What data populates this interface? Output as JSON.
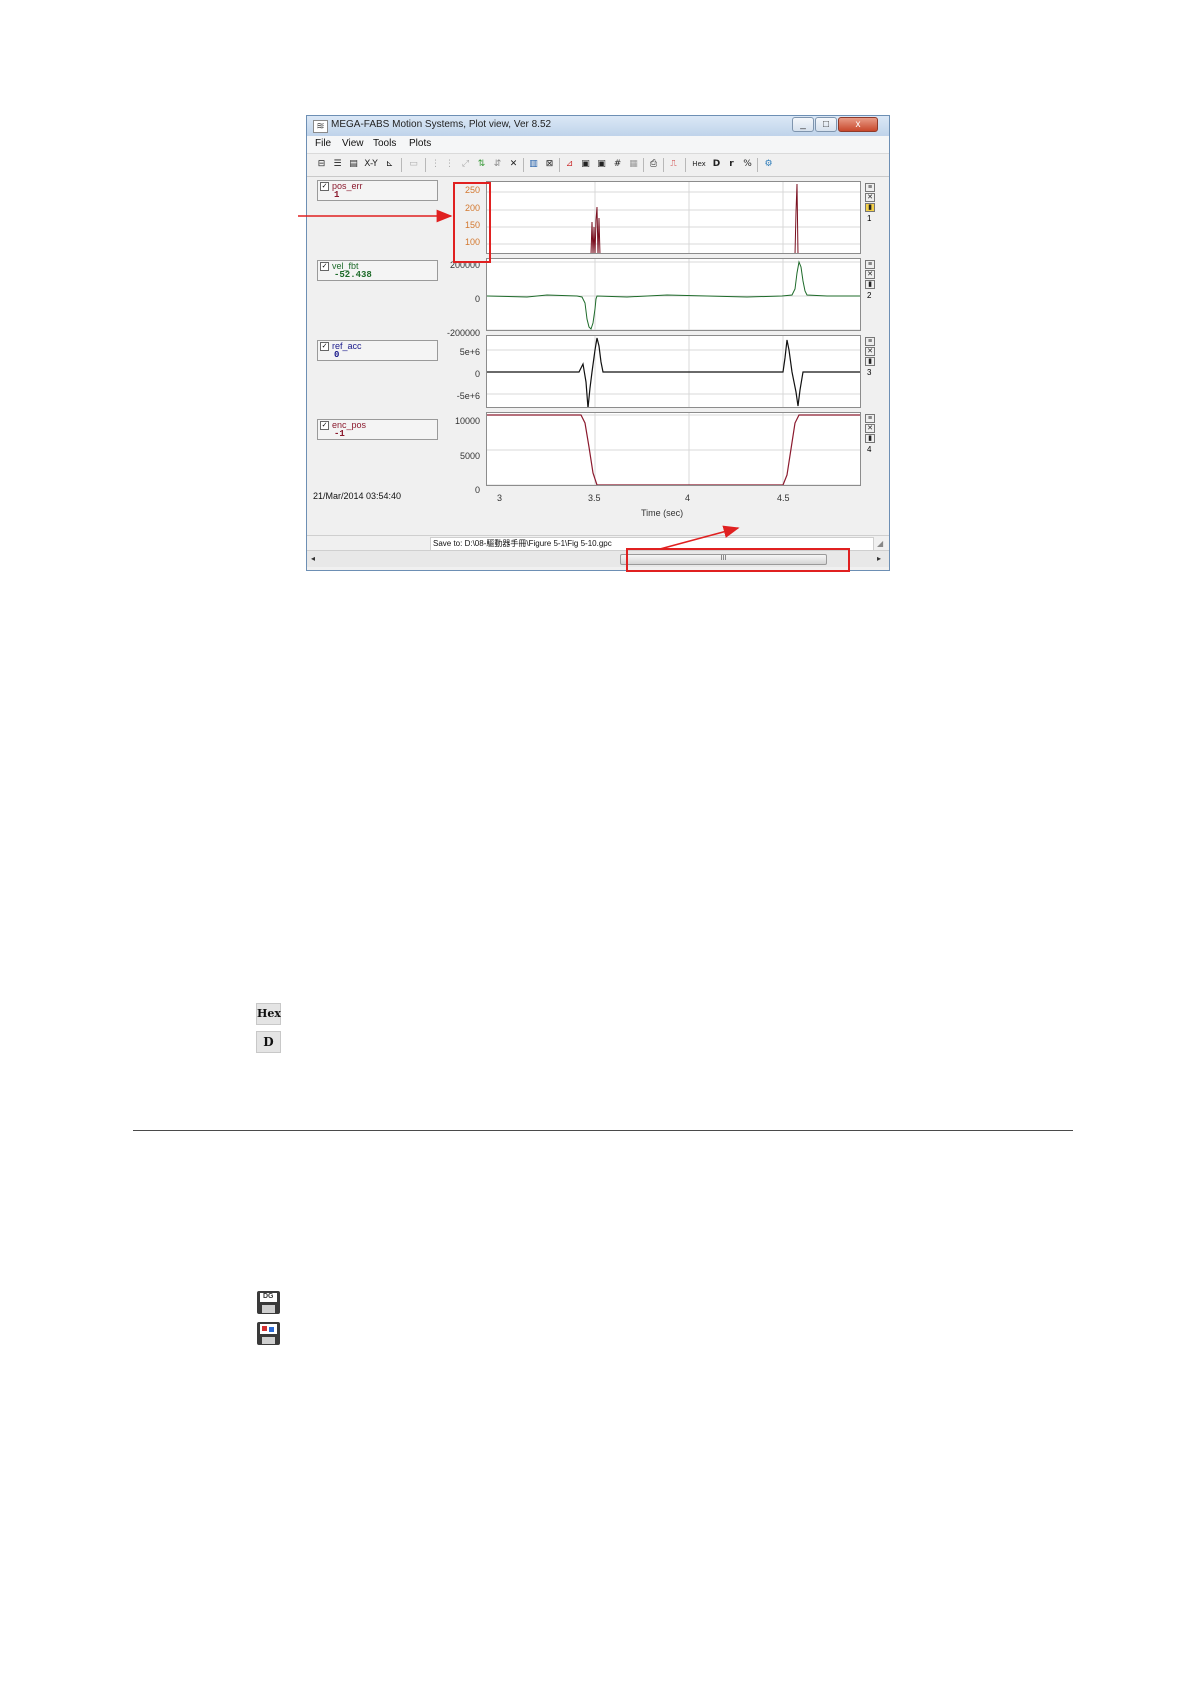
{
  "window": {
    "title": "MEGA-FABS Motion Systems, Plot view, Ver 8.52",
    "controls": [
      "_",
      "□",
      "x"
    ]
  },
  "menu": [
    "File",
    "View",
    "Tools",
    "Plots"
  ],
  "toolbar": {
    "xy_label": "X-Y",
    "hex_label": "Hex",
    "d_label": "D",
    "r_label": "r"
  },
  "signals": [
    {
      "name": "pos_err",
      "value": "1",
      "color": "#8b1a2e"
    },
    {
      "name": "vel_fbt",
      "value": "-52.438",
      "color": "#1e6b2a"
    },
    {
      "name": "ref_acc",
      "value": "0",
      "color": "#1a1a8b"
    },
    {
      "name": "enc_pos",
      "value": "-1",
      "color": "#8b1a2e"
    }
  ],
  "plots": [
    {
      "yticks": [
        "250",
        "200",
        "150",
        "100"
      ],
      "tick_color": "#d3782f",
      "number": "1"
    },
    {
      "yticks": [
        "200000",
        "0",
        "-200000"
      ],
      "tick_color": "#333333",
      "number": "2"
    },
    {
      "yticks": [
        "5e+6",
        "0",
        "-5e+6"
      ],
      "tick_color": "#333333",
      "number": "3"
    },
    {
      "yticks": [
        "10000",
        "5000",
        "0"
      ],
      "tick_color": "#333333",
      "number": "4"
    }
  ],
  "x_axis": {
    "ticks": [
      "3",
      "3.5",
      "4",
      "4.5"
    ],
    "label": "Time (sec)"
  },
  "timestamp": "21/Mar/2014  03:54:40",
  "status": {
    "save_to": "Save to: D:\\08-驅動器手冊\\Figure 5-1\\Fig 5-10.gpc"
  },
  "scroll": {
    "thumb_glyph": "III",
    "left_arrow": "◂",
    "right_arrow": "▸"
  },
  "annotation_color": "#e02020",
  "bottom_icons": [
    {
      "name": "hex-icon",
      "label": "Hex"
    },
    {
      "name": "d-icon",
      "label": "D"
    },
    {
      "name": "save-data-icon",
      "label": "DG"
    },
    {
      "name": "save-image-icon",
      "label": ""
    }
  ]
}
